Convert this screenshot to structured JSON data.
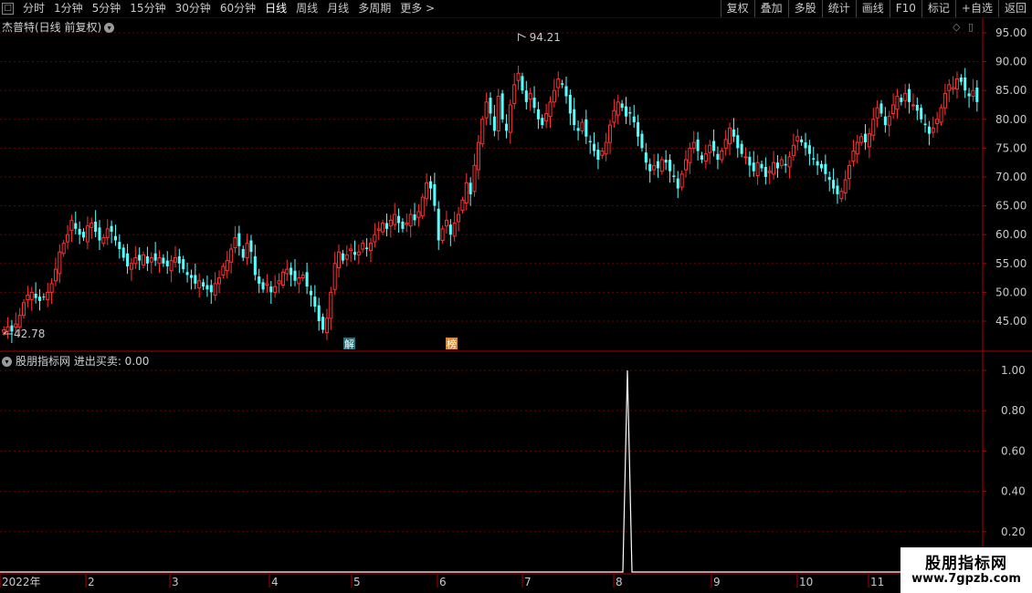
{
  "toolbar": {
    "periods": [
      "分时",
      "1分钟",
      "5分钟",
      "15分钟",
      "30分钟",
      "60分钟",
      "日线",
      "周线",
      "月线",
      "多周期",
      "更多 >"
    ],
    "active_index": 6,
    "right_buttons": [
      "复权",
      "叠加",
      "多股",
      "统计",
      "画线",
      "F10",
      "标记",
      "+自选",
      "返回"
    ]
  },
  "main_chart": {
    "title": "杰普特(日线 前复权)",
    "high_label": "94.21",
    "low_label": "42.78",
    "markers": [
      "解",
      "榜"
    ],
    "y_ticks": [
      "95.00",
      "90.00",
      "85.00",
      "80.00",
      "75.00",
      "70.00",
      "65.00",
      "60.00",
      "55.00",
      "50.00",
      "45.00"
    ],
    "up_color": "#ff3232",
    "down_color": "#54ffff"
  },
  "indicator": {
    "title": "股朋指标网 进出买卖: 0.00",
    "y_ticks": [
      "1.00",
      "0.80",
      "0.60",
      "0.40",
      "0.20"
    ]
  },
  "x_axis": {
    "labels": [
      "2022年",
      "2",
      "3",
      "4",
      "5",
      "6",
      "7",
      "8",
      "9",
      "10",
      "11"
    ]
  },
  "watermark": {
    "line1": "股朋指标网",
    "line2": "www.7gpzb.com"
  },
  "chart_data": [
    {
      "type": "candlestick",
      "title": "杰普特(日线 前复权)",
      "ylim": [
        41,
        96
      ],
      "y_ticks": [
        95,
        90,
        85,
        80,
        75,
        70,
        65,
        60,
        55,
        50,
        45
      ],
      "annotations": {
        "high": 94.21,
        "low": 42.78
      },
      "month_labels": [
        "2022年",
        "2",
        "3",
        "4",
        "5",
        "6",
        "7",
        "8",
        "9",
        "10",
        "11"
      ],
      "closes": [
        43.5,
        44.0,
        43.2,
        44.5,
        46.0,
        48.2,
        49.5,
        50.0,
        49.0,
        48.5,
        49.2,
        50.0,
        51.5,
        54.0,
        57.0,
        58.5,
        60.0,
        62.5,
        61.0,
        60.0,
        59.5,
        61.5,
        62.0,
        60.5,
        59.0,
        59.5,
        61.0,
        60.5,
        59.0,
        57.5,
        56.0,
        54.5,
        55.0,
        56.0,
        55.5,
        56.5,
        55.0,
        56.0,
        55.5,
        56.0,
        55.0,
        54.5,
        55.5,
        56.0,
        55.0,
        54.0,
        53.0,
        52.5,
        51.5,
        52.0,
        51.0,
        50.5,
        50.0,
        51.5,
        52.5,
        54.5,
        55.5,
        57.5,
        59.5,
        58.0,
        56.0,
        58.5,
        57.0,
        53.0,
        51.5,
        50.5,
        51.5,
        50.0,
        51.0,
        52.0,
        53.5,
        54.0,
        53.0,
        52.0,
        52.5,
        53.0,
        51.0,
        49.5,
        47.5,
        45.0,
        43.5,
        45.5,
        50.0,
        55.0,
        57.0,
        55.5,
        56.5,
        57.5,
        56.5,
        57.0,
        58.5,
        57.5,
        58.5,
        60.0,
        61.0,
        62.0,
        61.0,
        62.5,
        63.5,
        62.0,
        61.0,
        62.0,
        63.5,
        62.5,
        64.0,
        66.5,
        69.0,
        68.0,
        65.0,
        59.0,
        61.0,
        62.5,
        60.0,
        62.0,
        63.5,
        66.0,
        69.0,
        67.0,
        72.0,
        76.0,
        80.0,
        83.0,
        81.0,
        78.0,
        84.0,
        80.0,
        78.0,
        82.5,
        86.0,
        88.0,
        85.0,
        83.0,
        84.5,
        82.0,
        80.0,
        79.0,
        81.0,
        83.0,
        85.0,
        87.0,
        86.0,
        84.0,
        81.0,
        79.0,
        78.0,
        79.5,
        77.0,
        76.0,
        74.5,
        73.0,
        74.5,
        76.0,
        79.0,
        81.5,
        83.0,
        82.0,
        80.5,
        81.0,
        79.5,
        77.0,
        75.0,
        72.5,
        71.0,
        72.0,
        71.5,
        73.0,
        72.5,
        71.0,
        70.0,
        68.0,
        70.5,
        73.0,
        75.0,
        76.0,
        74.5,
        73.0,
        74.0,
        75.5,
        74.5,
        73.0,
        74.5,
        76.5,
        78.5,
        77.0,
        75.0,
        74.0,
        73.5,
        72.0,
        71.0,
        72.5,
        71.5,
        70.0,
        71.0,
        72.5,
        71.5,
        73.0,
        72.0,
        73.5,
        75.5,
        77.0,
        76.0,
        75.0,
        74.0,
        73.0,
        72.0,
        71.5,
        70.5,
        69.5,
        68.0,
        67.0,
        67.5,
        69.5,
        72.0,
        74.5,
        76.0,
        77.0,
        76.0,
        77.5,
        80.0,
        82.0,
        81.0,
        79.0,
        80.5,
        82.5,
        84.0,
        83.0,
        84.5,
        83.0,
        82.5,
        81.5,
        80.0,
        79.0,
        77.5,
        78.5,
        80.0,
        82.0,
        84.5,
        86.0,
        85.5,
        87.0,
        86.5,
        85.0,
        84.0,
        85.0,
        83.0
      ]
    },
    {
      "type": "line",
      "title": "股朋指标网 进出买卖: 0.00",
      "ylim": [
        0,
        1.05
      ],
      "y_ticks": [
        1.0,
        0.8,
        0.6,
        0.4,
        0.2
      ],
      "spike": {
        "value": 1.0,
        "month": "8"
      },
      "baseline": 0
    }
  ]
}
